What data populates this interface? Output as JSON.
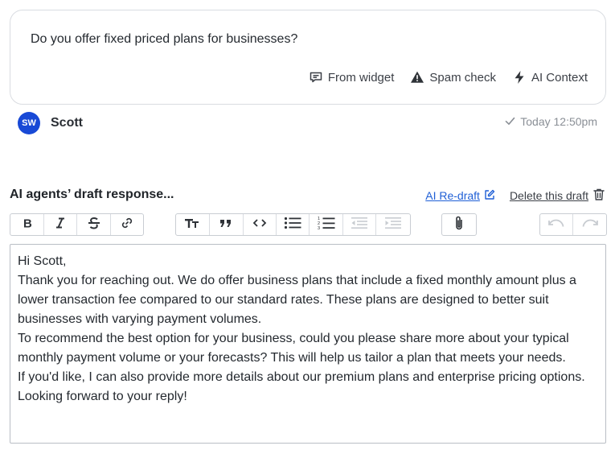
{
  "message": {
    "text": "Do you offer fixed priced plans for businesses?",
    "meta": {
      "from_widget": "From widget",
      "spam_check": "Spam check",
      "ai_context": "AI Context"
    }
  },
  "author": {
    "initials": "SW",
    "name": "Scott",
    "timestamp": "Today 12:50pm"
  },
  "draft": {
    "title": "AI agents’ draft response...",
    "redraft_label": "AI Re-draft",
    "delete_label": "Delete this draft",
    "body": [
      "Hi Scott,",
      "Thank you for reaching out. We do offer business plans that include a fixed monthly amount plus a lower transaction fee compared to our standard rates. These plans are designed to better suit businesses with varying payment volumes.",
      "To recommend the best option for your business, could you please share more about your typical monthly payment volume or your forecasts? This will help us tailor a plan that meets your needs.",
      "If you'd like, I can also provide more details about our premium plans and enterprise pricing options.",
      "Looking forward to your reply!"
    ]
  },
  "toolbar": {
    "icons": [
      "bold-icon",
      "italic-icon",
      "strikethrough-icon",
      "link-icon",
      "text-size-icon",
      "quote-icon",
      "code-icon",
      "bullet-list-icon",
      "numbered-list-icon",
      "outdent-icon",
      "indent-icon",
      "attachment-icon",
      "undo-icon",
      "redo-icon"
    ]
  },
  "colors": {
    "avatar": "#1849d6",
    "link": "#1f5fd6",
    "muted": "#8a8f96"
  }
}
